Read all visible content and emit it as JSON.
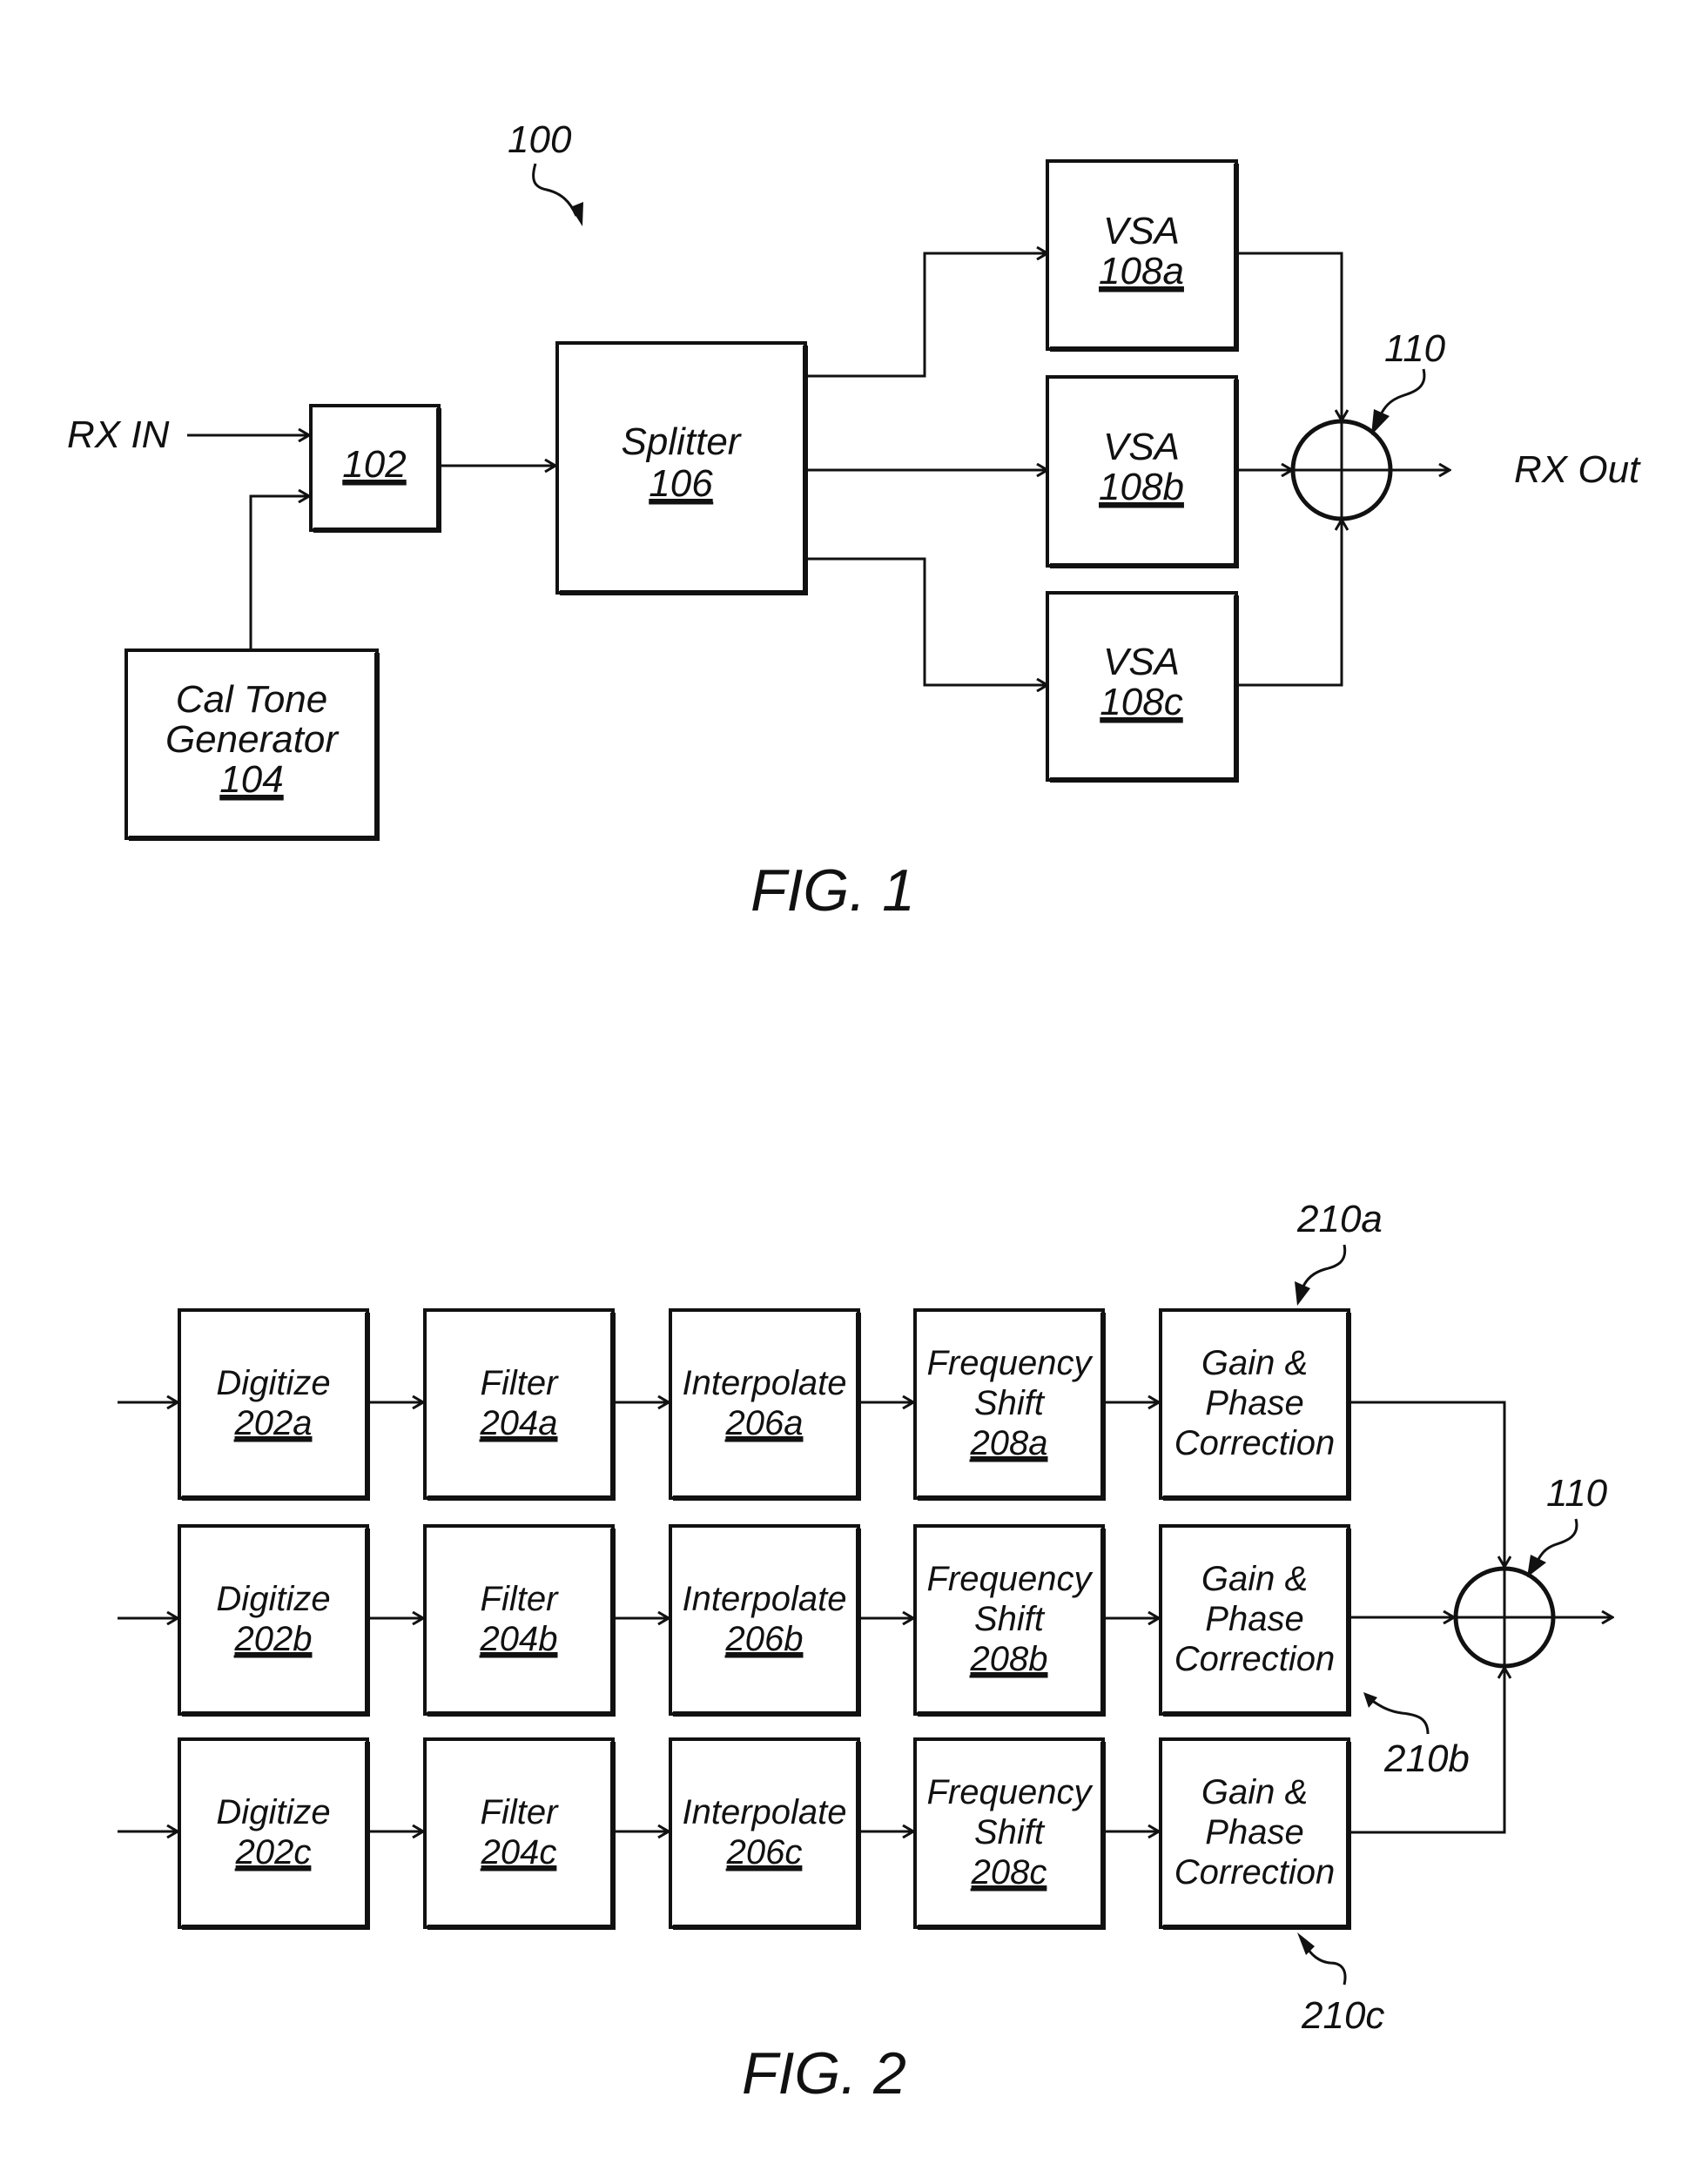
{
  "fig1": {
    "ref_label": "100",
    "caption": "FIG. 1",
    "rx_in": "RX IN",
    "rx_out": "RX Out",
    "combiner_ref": "110",
    "blocks": {
      "b102": {
        "title": "",
        "ref": "102"
      },
      "b104": {
        "title_lines": [
          "Cal Tone",
          "Generator"
        ],
        "ref": "104"
      },
      "b106": {
        "title": "Splitter",
        "ref": "106"
      },
      "b108a": {
        "title": "VSA",
        "ref": "108a"
      },
      "b108b": {
        "title": "VSA",
        "ref": "108b"
      },
      "b108c": {
        "title": "VSA",
        "ref": "108c"
      }
    }
  },
  "fig2": {
    "caption": "FIG. 2",
    "combiner_ref": "110",
    "gain_refs": [
      "210a",
      "210b",
      "210c"
    ],
    "rows": [
      {
        "digitize": {
          "title": "Digitize",
          "ref": "202a"
        },
        "filter": {
          "title": "Filter",
          "ref": "204a"
        },
        "interpolate": {
          "title": "Interpolate",
          "ref": "206a"
        },
        "freq": {
          "title_lines": [
            "Frequency",
            "Shift"
          ],
          "ref": "208a"
        },
        "gain": {
          "title_lines": [
            "Gain &",
            "Phase",
            "Correction"
          ]
        }
      },
      {
        "digitize": {
          "title": "Digitize",
          "ref": "202b"
        },
        "filter": {
          "title": "Filter",
          "ref": "204b"
        },
        "interpolate": {
          "title": "Interpolate",
          "ref": "206b"
        },
        "freq": {
          "title_lines": [
            "Frequency",
            "Shift"
          ],
          "ref": "208b"
        },
        "gain": {
          "title_lines": [
            "Gain &",
            "Phase",
            "Correction"
          ]
        }
      },
      {
        "digitize": {
          "title": "Digitize",
          "ref": "202c"
        },
        "filter": {
          "title": "Filter",
          "ref": "204c"
        },
        "interpolate": {
          "title": "Interpolate",
          "ref": "206c"
        },
        "freq": {
          "title_lines": [
            "Frequency",
            "Shift"
          ],
          "ref": "208c"
        },
        "gain": {
          "title_lines": [
            "Gain &",
            "Phase",
            "Correction"
          ]
        }
      }
    ]
  }
}
